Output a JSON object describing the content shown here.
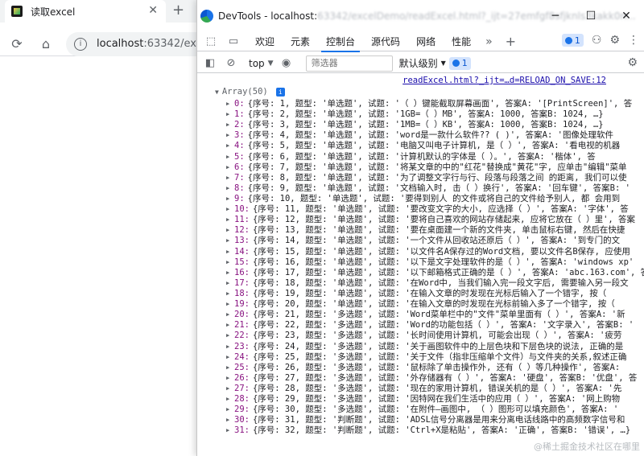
{
  "browser": {
    "tab_title": "读取excel",
    "close_glyph": "✕",
    "new_tab_glyph": "+",
    "url_host": "localhost",
    "url_rest": ":63342/excel",
    "info_glyph": "i"
  },
  "devtools": {
    "title_prefix": "DevTools - localhost:",
    "title_blurred": "63342/excelDemo/readExcel.html?_ijt=27emfgf8sfjknls3kakk0n...",
    "win_min": "─",
    "win_max": "☐",
    "win_close": "✕",
    "tabs": [
      "欢迎",
      "元素",
      "控制台",
      "源代码",
      "网络",
      "性能"
    ],
    "active_tab": "控制台",
    "more_tabs_glyph": "»",
    "add_tab_glyph": "+",
    "issues_count": "1",
    "context": "top",
    "filter_placeholder": "筛选器",
    "levels_label": "默认级别",
    "levels_issue_count": "1",
    "source_link": "readExcel.html?_ijt=…d=RELOAD_ON_SAVE:12",
    "array_label": "Array(50)",
    "watermark": "@稀土掘金技术社区在哪里"
  },
  "console_rows": [
    {
      "i": "0",
      "t": "{序号: 1, 题型: '单选题', 试题: '（  ）键能截取屏幕画面', 答案A: '[PrintScreen]', 答"
    },
    {
      "i": "1",
      "t": "{序号: 2, 题型: '单选题', 试题: '1GB=（    ）MB', 答案A: 1000, 答案B: 1024, …}"
    },
    {
      "i": "2",
      "t": "{序号: 3, 题型: '单选题', 试题: '1MB=（    ）KB', 答案A: 1000, 答案B: 1024, …}"
    },
    {
      "i": "3",
      "t": "{序号: 4, 题型: '单选题', 试题: 'word是一款什么软件?? (     )', 答案A: '图像处理软件"
    },
    {
      "i": "4",
      "t": "{序号: 5, 题型: '单选题', 试题: '电脑又叫电子计算机, 是（  ）', 答案A: '看电视的机器"
    },
    {
      "i": "5",
      "t": "{序号: 6, 题型: '单选题', 试题: '计算机默认的字体是（          ）。', 答案A: '楷体', 答"
    },
    {
      "i": "6",
      "t": "{序号: 7, 题型: '单选题', 试题: '将某文章的中的\"红花\"替换成\"黄花\"字, 应单击\"编辑\"菜单"
    },
    {
      "i": "7",
      "t": "{序号: 8, 题型: '单选题', 试题: '为了调整文字行与行、段落与段落之间 的距离, 我们可以使"
    },
    {
      "i": "8",
      "t": "{序号: 9, 题型: '单选题', 试题: '文档输入时, 击（  ）换行', 答案A: '回车键', 答案B: '"
    },
    {
      "i": "9",
      "t": "{序号: 10, 题型: '单选题', 试题: '要得到别人 的文件或将自己的文件给予别人, 都 会用到"
    },
    {
      "i": "10",
      "t": "{序号: 11, 题型: '单选题', 试题: '要改变文字的大小, 应选择（ ）', 答案A: '字体', 答"
    },
    {
      "i": "11",
      "t": "{序号: 12, 题型: '单选题', 试题: '要将自己喜欢的网站存储起来, 应将它放在（ ）里', 答案"
    },
    {
      "i": "12",
      "t": "{序号: 13, 题型: '单选题', 试题: '要在桌面建一个新的文件夹, 单击鼠标右键, 然后在快捷"
    },
    {
      "i": "13",
      "t": "{序号: 14, 题型: '单选题', 试题: '一个文件从回收站还原后（     ）', 答案A: '到专门的文"
    },
    {
      "i": "14",
      "t": "{序号: 15, 题型: '单选题', 试题: '以文件名A保存过的Word文档, 要以文件名B保存, 应使用"
    },
    {
      "i": "15",
      "t": "{序号: 16, 题型: '单选题', 试题: '以下是文字处理软件的是（ ）', 答案A: 'windows xp'"
    },
    {
      "i": "16",
      "t": "{序号: 17, 题型: '单选题', 试题: '以下邮箱格式正确的是（ ）', 答案A: 'abc.163.com', 答"
    },
    {
      "i": "17",
      "t": "{序号: 18, 题型: '单选题', 试题: '在Word中, 当我们输入完一段文字后, 需要输入另一段文"
    },
    {
      "i": "18",
      "t": "{序号: 19, 题型: '单选题', 试题: '在输入文章的时发现在光标后输入了一个错字, 按（"
    },
    {
      "i": "19",
      "t": "{序号: 20, 题型: '单选题', 试题: '在输入文章的时发现在光标前输入多了一个错字, 按（"
    },
    {
      "i": "20",
      "t": "{序号: 21, 题型: '多选题', 试题: 'Word菜单栏中的\"文件\"菜单里面有（  ）', 答案A: '新"
    },
    {
      "i": "21",
      "t": "{序号: 22, 题型: '多选题', 试题: 'Word的功能包括（  ）', 答案A: '文字录入', 答案B: '"
    },
    {
      "i": "22",
      "t": "{序号: 23, 题型: '多选题', 试题: '长时间使用计算机, 可能会出现（  ）', 答案A: '疲劳"
    },
    {
      "i": "23",
      "t": "{序号: 24, 题型: '多选题', 试题: '关于画图软件中的上层色块和下层色块的说法, 正确的是"
    },
    {
      "i": "24",
      "t": "{序号: 25, 题型: '多选题', 试题: '关于文件（指非压缩单个文件）与文件夹的关系,叙述正确"
    },
    {
      "i": "25",
      "t": "{序号: 26, 题型: '多选题', 试题: '鼠标除了单击操作外, 还有（  ）等几种操作', 答案A: "
    },
    {
      "i": "26",
      "t": "{序号: 27, 题型: '多选题', 试题: '外存储器有（  ）', 答案A: '硬盘', 答案B: '优盘', 答"
    },
    {
      "i": "27",
      "t": "{序号: 28, 题型: '多选题', 试题: '现在的家用计算机, 错误关机的是（  ）', 答案A: '先"
    },
    {
      "i": "28",
      "t": "{序号: 29, 题型: '多选题', 试题: '因特网在我们生活中的应用（  ）', 答案A: '网上购物"
    },
    {
      "i": "29",
      "t": "{序号: 30, 题型: '多选题', 试题: '在附件—画图中, （   ）图形可以填充颜色', 答案A: '"
    },
    {
      "i": "30",
      "t": "{序号: 31, 题型: '判断题', 试题: 'ADSL信号分离器是用来分离电话线路中的高频数字信号和"
    },
    {
      "i": "31",
      "t": "{序号: 32, 题型: '判断题', 试题: 'Ctrl+X是粘贴', 答案A: '正确', 答案B: '错误', …}"
    }
  ]
}
